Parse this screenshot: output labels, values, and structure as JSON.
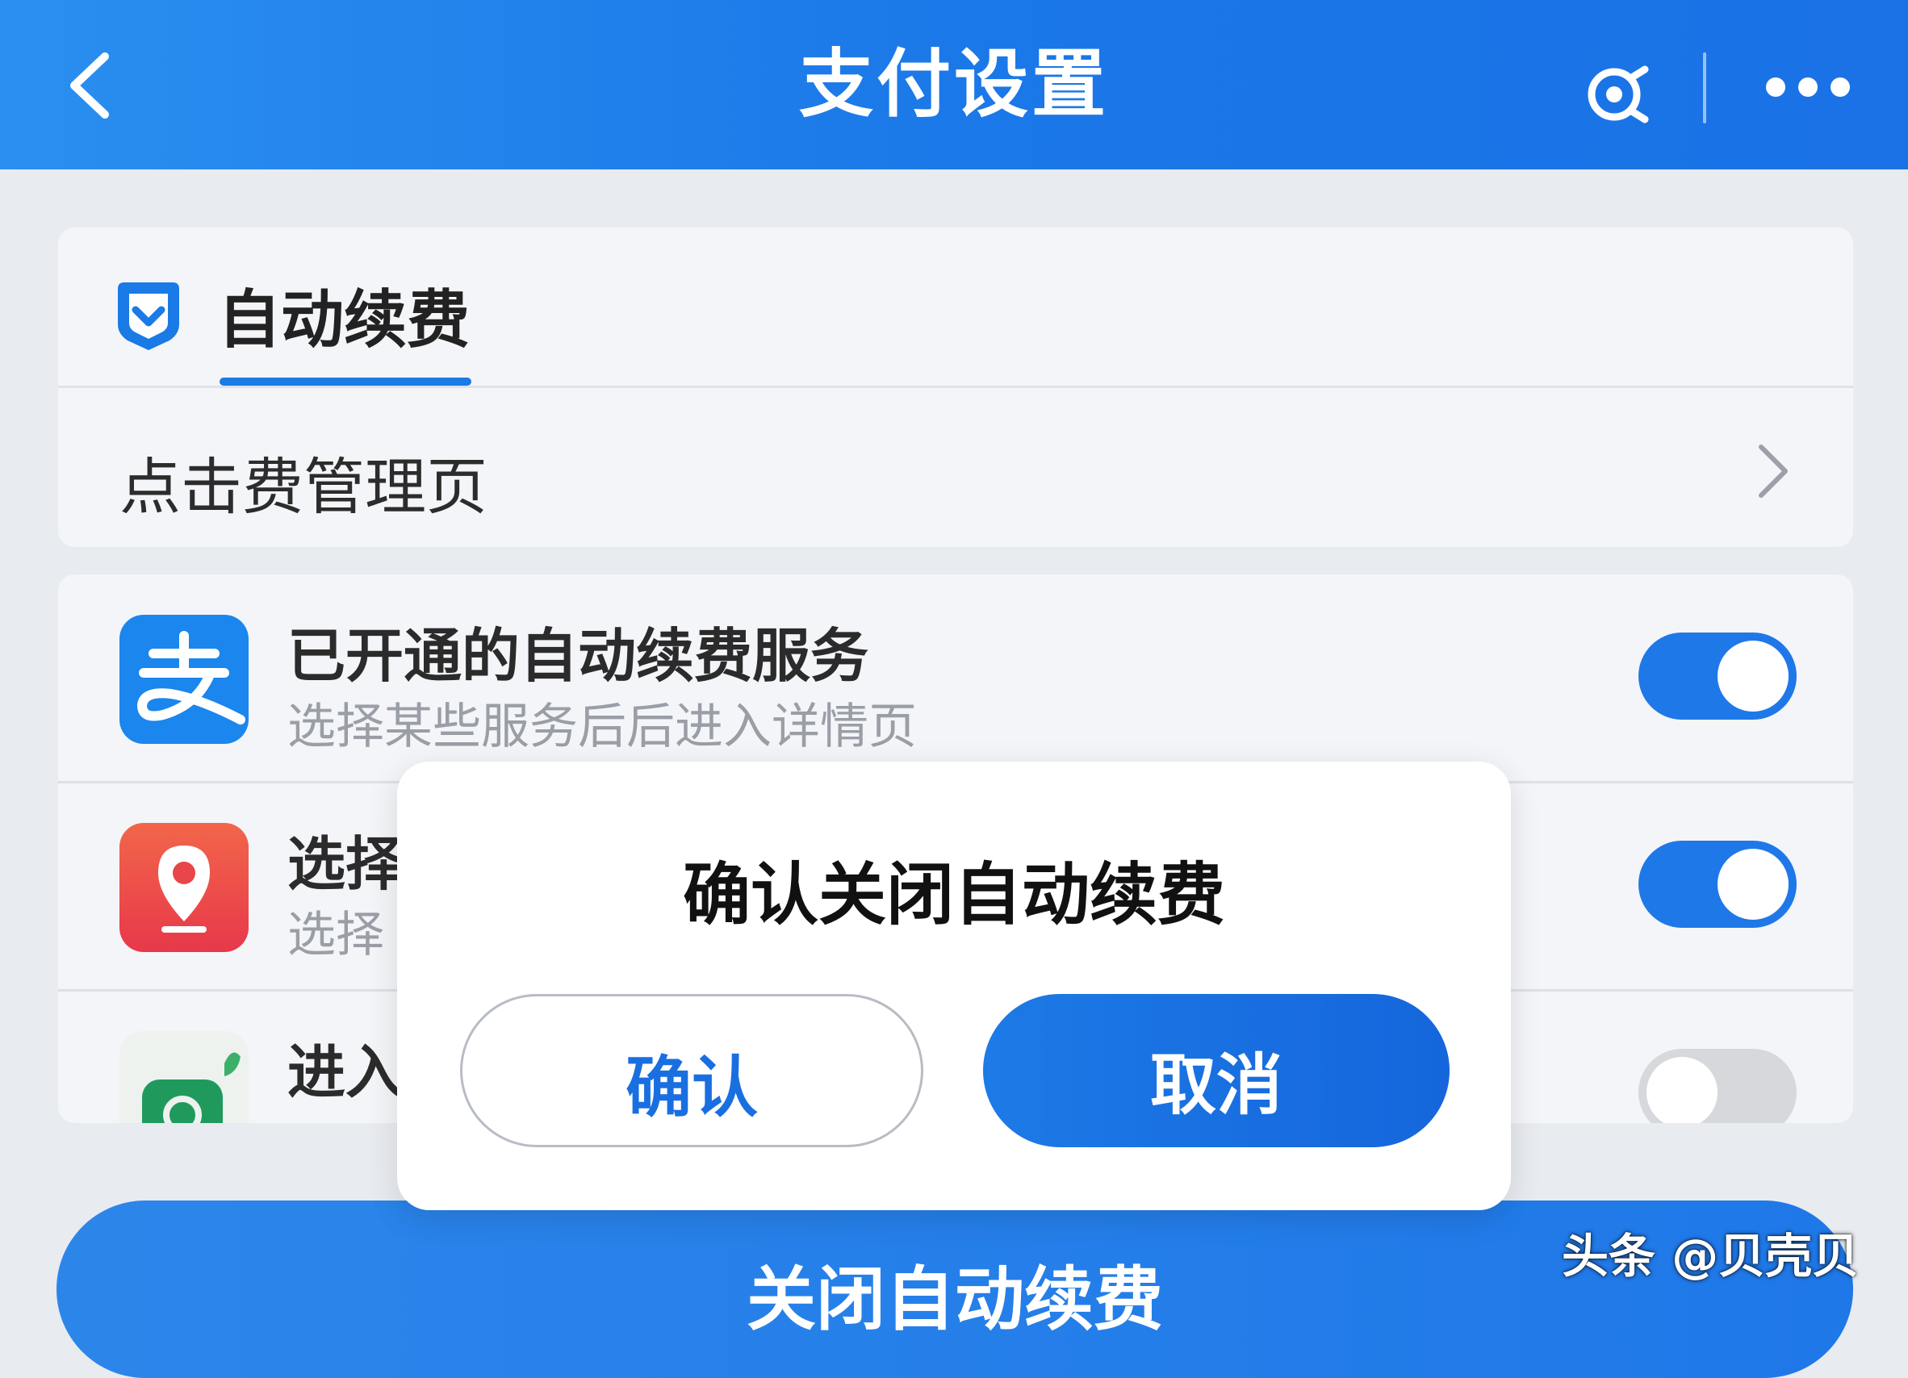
{
  "header": {
    "title": "支付设置",
    "icon_back": "chevron-left-icon",
    "icon_scan": "scan-icon",
    "icon_more": "more-dots-icon"
  },
  "auto_renew_card": {
    "tab_label": "自动续费",
    "tab_icon": "shield-check-icon",
    "manage_label": "点击费管理页"
  },
  "services": [
    {
      "title": "已开通的自动续费服务",
      "subtitle": "选择某些服务后后进入详情页",
      "icon": "alipay-icon",
      "toggle_on": true
    },
    {
      "title": "选择",
      "subtitle": "选择",
      "icon": "location-pin-icon",
      "toggle_on": true
    },
    {
      "title": "进入",
      "subtitle": "",
      "icon": "phone-icon",
      "toggle_on": false
    }
  ],
  "bottom_button": {
    "label": "关闭自动续费"
  },
  "watermark": "头条 @贝壳贝",
  "dialog": {
    "title": "确认关闭自动续费",
    "confirm_label": "确认",
    "cancel_label": "取消"
  },
  "colors": {
    "brand_blue": "#1f78e8",
    "background": "#e8ebf0",
    "card": "#f4f5f8"
  }
}
